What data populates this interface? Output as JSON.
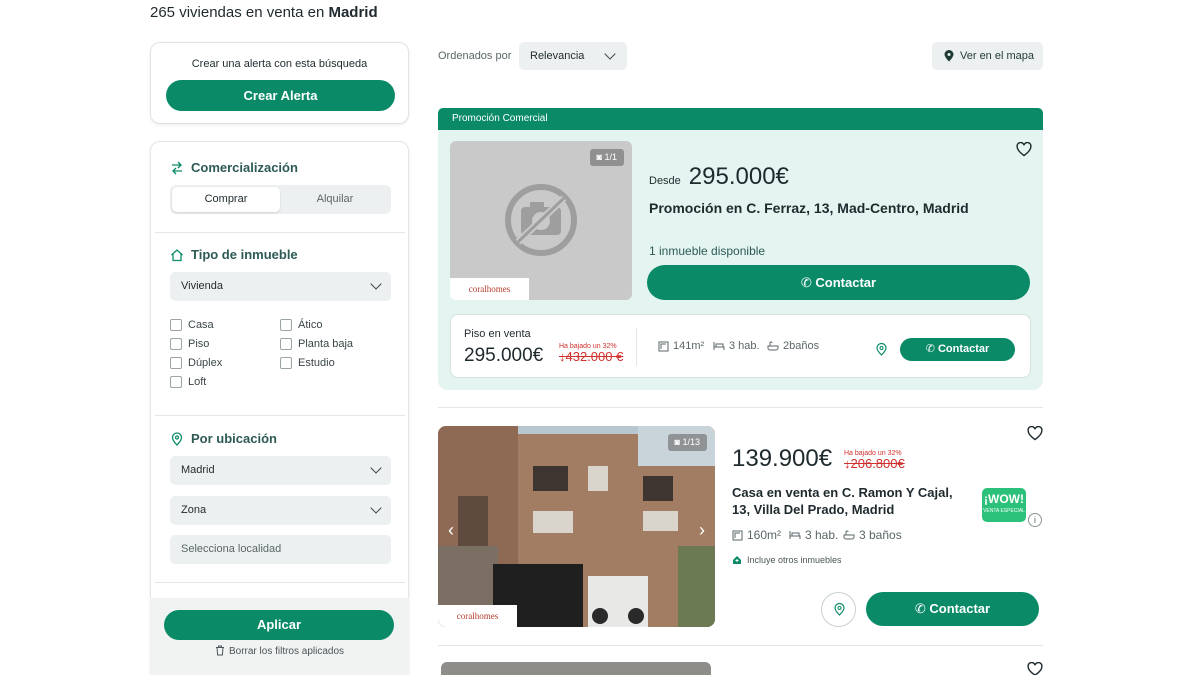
{
  "header": {
    "count_text": "265 viviendas en venta en",
    "city": "Madrid"
  },
  "alert": {
    "text": "Crear una alerta con esta búsqueda",
    "button": "Crear Alerta"
  },
  "filters": {
    "commercialization": {
      "title": "Comercialización",
      "options": [
        "Comprar",
        "Alquilar"
      ],
      "selected": "Comprar"
    },
    "property_type": {
      "title": "Tipo de inmueble",
      "selected": "Vivienda",
      "checkboxes_left": [
        "Casa",
        "Piso",
        "Dúplex",
        "Loft"
      ],
      "checkboxes_right": [
        "Ático",
        "Planta baja",
        "Estudio"
      ]
    },
    "location": {
      "title": "Por ubicación",
      "province": "Madrid",
      "zone": "Zona",
      "locality_placeholder": "Selecciona localidad"
    },
    "apply_button": "Aplicar",
    "clear_text": "Borrar los filtros aplicados"
  },
  "toolbar": {
    "sort_label": "Ordenados por",
    "sort_value": "Relevancia",
    "map_button": "Ver en el mapa"
  },
  "promotion": {
    "banner": "Promoción Comercial",
    "photo_count": "1/1",
    "brand": "coralhomes",
    "from_label": "Desde",
    "price": "295.000€",
    "title": "Promoción en C. Ferraz, 13, Mad-Centro, Madrid",
    "available": "1 inmueble disponible",
    "contact": "Contactar",
    "unit": {
      "type": "Piso en venta",
      "price": "295.000€",
      "drop_note": "Ha bajado un 32%",
      "old_price": "432.000 €",
      "area": "141m²",
      "rooms": "3 hab.",
      "baths": "2baños",
      "contact": "Contactar"
    }
  },
  "listing": {
    "photo_count": "1/13",
    "brand": "coralhomes",
    "price": "139.900€",
    "drop_note": "Ha bajado un 32%",
    "old_price": "206.800€",
    "title": "Casa en venta en C. Ramon Y Cajal, 13, Villa Del Prado, Madrid",
    "area": "160m²",
    "rooms": "3 hab.",
    "baths": "3 baños",
    "includes": "Incluye otros inmuebles",
    "badge_main": "¡WOW!",
    "badge_sub": "VENTA ESPECIAL",
    "contact": "Contactar"
  },
  "colors": {
    "accent": "#0a8a67",
    "promo_bg": "#e4f4f0",
    "price_drop": "#d0312d"
  }
}
